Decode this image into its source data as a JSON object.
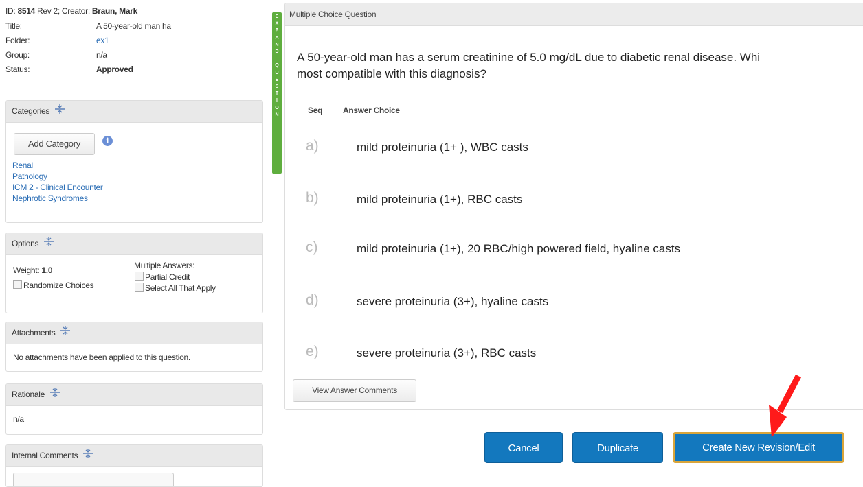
{
  "info": {
    "id_label": "ID: ",
    "id_value": "8514",
    "rev": " Rev 2",
    "creator_label": "; Creator: ",
    "creator_value": "Braun, Mark",
    "rows": [
      {
        "label": "Title:",
        "value": "A 50-year-old man ha"
      },
      {
        "label": "Folder:",
        "value": "ex1"
      },
      {
        "label": "Group:",
        "value": "n/a"
      },
      {
        "label": "Status:",
        "value": "Approved"
      }
    ]
  },
  "categories": {
    "header": "Categories",
    "add_button": "Add Category",
    "info_icon_glyph": "i",
    "items": [
      "Renal",
      "Pathology",
      "ICM 2 - Clinical Encounter",
      "Nephrotic Syndromes"
    ]
  },
  "options": {
    "header": "Options",
    "weight_label": "Weight: ",
    "weight_value": "1.0",
    "randomize": "Randomize Choices",
    "multiple_answers": "Multiple Answers:",
    "partial_credit": "Partial Credit",
    "select_all": "Select All That Apply"
  },
  "attachments": {
    "header": "Attachments",
    "text": "No attachments have been applied to this question."
  },
  "rationale": {
    "header": "Rationale",
    "text": "n/a"
  },
  "internal_comments": {
    "header": "Internal Comments"
  },
  "expand_bar": {
    "text": "EXPAND QUESTION"
  },
  "question": {
    "header": "Multiple Choice Question",
    "text_line1": "A 50-year-old man has a serum creatinine of 5.0 mg/dL due to diabetic renal disease. Whi",
    "text_line2": "most compatible with this diagnosis?",
    "col_seq": "Seq",
    "col_answer": "Answer Choice",
    "choices": [
      {
        "letter": "a)",
        "text": "mild proteinuria (1+ ), WBC casts"
      },
      {
        "letter": "b)",
        "text": "mild proteinuria (1+), RBC casts"
      },
      {
        "letter": "c)",
        "text": "mild proteinuria (1+), 20 RBC/high powered field, hyaline casts"
      },
      {
        "letter": "d)",
        "text": "severe proteinuria (3+), hyaline casts"
      },
      {
        "letter": "e)",
        "text": "severe proteinuria (3+), RBC casts"
      }
    ],
    "view_comments": "View Answer Comments"
  },
  "actions": {
    "cancel": "Cancel",
    "duplicate": "Duplicate",
    "create_revision": "Create New Revision/Edit"
  },
  "colors": {
    "primary_button": "#1378be",
    "highlight_border": "#d9a53b",
    "expand_bar": "#5fae3e",
    "annotation_arrow": "#ff1a1a",
    "link": "#2a6db5"
  },
  "icons": {
    "collapse": "collapse-icon",
    "info": "info-icon",
    "annotation": "red-arrow-annotation"
  }
}
